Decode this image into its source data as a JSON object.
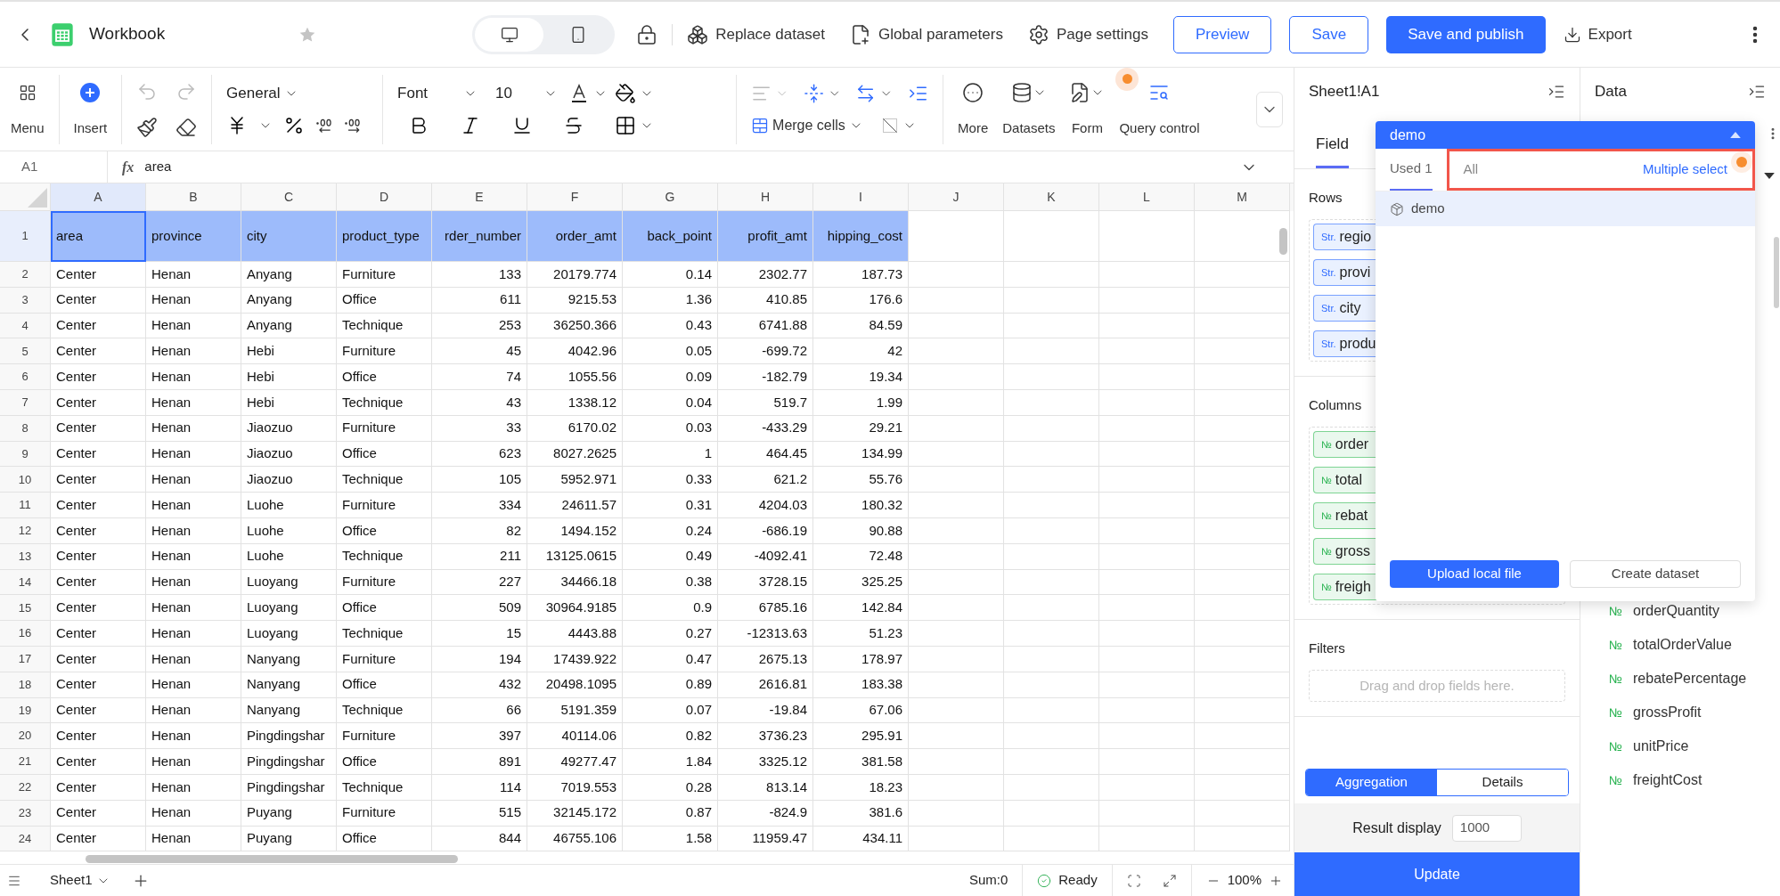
{
  "header": {
    "title": "Workbook",
    "device_modes": [
      {
        "kind": "desktop",
        "selected": true
      },
      {
        "kind": "mobile",
        "selected": false
      }
    ],
    "actions": [
      "Replace dataset",
      "Global parameters",
      "Page settings"
    ],
    "buttons": [
      {
        "label": "Preview",
        "kind": "outline"
      },
      {
        "label": "Save",
        "kind": "outline"
      },
      {
        "label": "Save and publish",
        "kind": "primary"
      }
    ],
    "export": "Export"
  },
  "toolbar": {
    "menu": "Menu",
    "insert": "Insert",
    "number_format": "General",
    "font": "Font",
    "font_size": "10",
    "merge": "Merge cells",
    "more": "More",
    "datasets": "Datasets",
    "form": "Form",
    "query": "Query control"
  },
  "formula_bar": {
    "cell": "A1",
    "fx": "fx",
    "value": "area"
  },
  "sheet": {
    "columns": [
      {
        "label": "A",
        "kind": "text",
        "selected": true
      },
      {
        "label": "B",
        "kind": "text",
        "selected": false
      },
      {
        "label": "C",
        "kind": "text",
        "selected": false
      },
      {
        "label": "D",
        "kind": "text",
        "selected": false
      },
      {
        "label": "E",
        "kind": "number",
        "selected": false
      },
      {
        "label": "F",
        "kind": "number",
        "selected": false
      },
      {
        "label": "G",
        "kind": "number",
        "selected": false
      },
      {
        "label": "H",
        "kind": "number",
        "selected": false
      },
      {
        "label": "I",
        "kind": "number",
        "selected": false
      },
      {
        "label": "J",
        "kind": "text",
        "selected": false
      },
      {
        "label": "K",
        "kind": "text",
        "selected": false
      },
      {
        "label": "L",
        "kind": "text",
        "selected": false
      },
      {
        "label": "M",
        "kind": "text",
        "selected": false
      }
    ],
    "rows": [
      {
        "number": "1",
        "kind": "header",
        "selected": true,
        "cells": [
          "area",
          "province",
          "city",
          "product_type",
          "rder_number",
          "order_amt",
          "back_point",
          "profit_amt",
          "hipping_cost"
        ]
      },
      {
        "number": "2",
        "kind": "data",
        "selected": false,
        "cells": [
          "Center",
          "Henan",
          "Anyang",
          "Furniture",
          "133",
          "20179.774",
          "0.14",
          "2302.77",
          "187.73"
        ]
      },
      {
        "number": "3",
        "kind": "data",
        "selected": false,
        "cells": [
          "Center",
          "Henan",
          "Anyang",
          "Office",
          "611",
          "9215.53",
          "1.36",
          "410.85",
          "176.6"
        ]
      },
      {
        "number": "4",
        "kind": "data",
        "selected": false,
        "cells": [
          "Center",
          "Henan",
          "Anyang",
          "Technique",
          "253",
          "36250.366",
          "0.43",
          "6741.88",
          "84.59"
        ]
      },
      {
        "number": "5",
        "kind": "data",
        "selected": false,
        "cells": [
          "Center",
          "Henan",
          "Hebi",
          "Furniture",
          "45",
          "4042.96",
          "0.05",
          "-699.72",
          "42"
        ]
      },
      {
        "number": "6",
        "kind": "data",
        "selected": false,
        "cells": [
          "Center",
          "Henan",
          "Hebi",
          "Office",
          "74",
          "1055.56",
          "0.09",
          "-182.79",
          "19.34"
        ]
      },
      {
        "number": "7",
        "kind": "data",
        "selected": false,
        "cells": [
          "Center",
          "Henan",
          "Hebi",
          "Technique",
          "43",
          "1338.12",
          "0.04",
          "519.7",
          "1.99"
        ]
      },
      {
        "number": "8",
        "kind": "data",
        "selected": false,
        "cells": [
          "Center",
          "Henan",
          "Jiaozuo",
          "Furniture",
          "33",
          "6170.02",
          "0.03",
          "-433.29",
          "29.21"
        ]
      },
      {
        "number": "9",
        "kind": "data",
        "selected": false,
        "cells": [
          "Center",
          "Henan",
          "Jiaozuo",
          "Office",
          "623",
          "8027.2625",
          "1",
          "464.45",
          "134.99"
        ]
      },
      {
        "number": "10",
        "kind": "data",
        "selected": false,
        "cells": [
          "Center",
          "Henan",
          "Jiaozuo",
          "Technique",
          "105",
          "5952.971",
          "0.33",
          "621.2",
          "55.76"
        ]
      },
      {
        "number": "11",
        "kind": "data",
        "selected": false,
        "cells": [
          "Center",
          "Henan",
          "Luohe",
          "Furniture",
          "334",
          "24611.57",
          "0.31",
          "4204.03",
          "180.32"
        ]
      },
      {
        "number": "12",
        "kind": "data",
        "selected": false,
        "cells": [
          "Center",
          "Henan",
          "Luohe",
          "Office",
          "82",
          "1494.152",
          "0.24",
          "-686.19",
          "90.88"
        ]
      },
      {
        "number": "13",
        "kind": "data",
        "selected": false,
        "cells": [
          "Center",
          "Henan",
          "Luohe",
          "Technique",
          "211",
          "13125.0615",
          "0.49",
          "-4092.41",
          "72.48"
        ]
      },
      {
        "number": "14",
        "kind": "data",
        "selected": false,
        "cells": [
          "Center",
          "Henan",
          "Luoyang",
          "Furniture",
          "227",
          "34466.18",
          "0.38",
          "3728.15",
          "325.25"
        ]
      },
      {
        "number": "15",
        "kind": "data",
        "selected": false,
        "cells": [
          "Center",
          "Henan",
          "Luoyang",
          "Office",
          "509",
          "30964.9185",
          "0.9",
          "6785.16",
          "142.84"
        ]
      },
      {
        "number": "16",
        "kind": "data",
        "selected": false,
        "cells": [
          "Center",
          "Henan",
          "Luoyang",
          "Technique",
          "15",
          "4443.88",
          "0.27",
          "-12313.63",
          "51.23"
        ]
      },
      {
        "number": "17",
        "kind": "data",
        "selected": false,
        "cells": [
          "Center",
          "Henan",
          "Nanyang",
          "Furniture",
          "194",
          "17439.922",
          "0.47",
          "2675.13",
          "178.97"
        ]
      },
      {
        "number": "18",
        "kind": "data",
        "selected": false,
        "cells": [
          "Center",
          "Henan",
          "Nanyang",
          "Office",
          "432",
          "20498.1095",
          "0.89",
          "2616.81",
          "183.38"
        ]
      },
      {
        "number": "19",
        "kind": "data",
        "selected": false,
        "cells": [
          "Center",
          "Henan",
          "Nanyang",
          "Technique",
          "66",
          "5191.359",
          "0.07",
          "-19.84",
          "67.06"
        ]
      },
      {
        "number": "20",
        "kind": "data",
        "selected": false,
        "cells": [
          "Center",
          "Henan",
          "Pingdingshar",
          "Furniture",
          "397",
          "40114.06",
          "0.82",
          "3736.23",
          "295.91"
        ]
      },
      {
        "number": "21",
        "kind": "data",
        "selected": false,
        "cells": [
          "Center",
          "Henan",
          "Pingdingshar",
          "Office",
          "891",
          "49277.47",
          "1.84",
          "3325.12",
          "381.58"
        ]
      },
      {
        "number": "22",
        "kind": "data",
        "selected": false,
        "cells": [
          "Center",
          "Henan",
          "Pingdingshar",
          "Technique",
          "114",
          "7019.553",
          "0.28",
          "813.14",
          "18.23"
        ]
      },
      {
        "number": "23",
        "kind": "data",
        "selected": false,
        "cells": [
          "Center",
          "Henan",
          "Puyang",
          "Furniture",
          "515",
          "32145.172",
          "0.87",
          "-824.9",
          "381.6"
        ]
      },
      {
        "number": "24",
        "kind": "data",
        "selected": false,
        "cells": [
          "Center",
          "Henan",
          "Puyang",
          "Office",
          "844",
          "46755.106",
          "1.58",
          "11959.47",
          "434.11"
        ]
      }
    ]
  },
  "status_bar": {
    "sheet_tab": "Sheet1",
    "sum": "Sum:0",
    "status": "Ready",
    "zoom": "100%"
  },
  "field_panel": {
    "title": "Sheet1!A1",
    "tabs": [
      {
        "label": "Field",
        "selected": true
      }
    ],
    "rows_label": "Rows",
    "row_fields": [
      {
        "kind": "dimension",
        "type_label": "Str.",
        "name": "regio"
      },
      {
        "kind": "dimension",
        "type_label": "Str.",
        "name": "provi"
      },
      {
        "kind": "dimension",
        "type_label": "Str.",
        "name": "city"
      },
      {
        "kind": "dimension",
        "type_label": "Str.",
        "name": "produ"
      }
    ],
    "columns_label": "Columns",
    "column_fields": [
      {
        "kind": "measure",
        "type_label": "№",
        "name": "order"
      },
      {
        "kind": "measure",
        "type_label": "№",
        "name": "total"
      },
      {
        "kind": "measure",
        "type_label": "№",
        "name": "rebat"
      },
      {
        "kind": "measure",
        "type_label": "№",
        "name": "gross"
      },
      {
        "kind": "measure",
        "type_label": "№",
        "name": "freigh"
      }
    ],
    "filters_label": "Filters",
    "filters_placeholder": "Drag and drop fields here.",
    "modes": [
      {
        "label": "Aggregation",
        "selected": true
      },
      {
        "label": "Details",
        "selected": false
      }
    ],
    "result_display_label": "Result display",
    "result_display_value": "1000",
    "update": "Update"
  },
  "data_panel": {
    "title": "Data",
    "fields": [
      {
        "type_label": "№",
        "name": "orderQuantity"
      },
      {
        "type_label": "№",
        "name": "totalOrderValue"
      },
      {
        "type_label": "№",
        "name": "rebatePercentage"
      },
      {
        "type_label": "№",
        "name": "grossProfit"
      },
      {
        "type_label": "№",
        "name": "unitPrice"
      },
      {
        "type_label": "№",
        "name": "freightCost"
      }
    ]
  },
  "dataset_dropdown": {
    "title": "demo",
    "tabs": [
      {
        "label": "Used 1",
        "selected": true
      },
      {
        "label": "All",
        "selected": false
      }
    ],
    "multi_select": "Multiple select",
    "items": [
      {
        "label": "demo",
        "selected": true
      }
    ],
    "buttons": [
      {
        "label": "Upload local file",
        "kind": "primary"
      },
      {
        "label": "Create dataset",
        "kind": "outline"
      }
    ]
  }
}
